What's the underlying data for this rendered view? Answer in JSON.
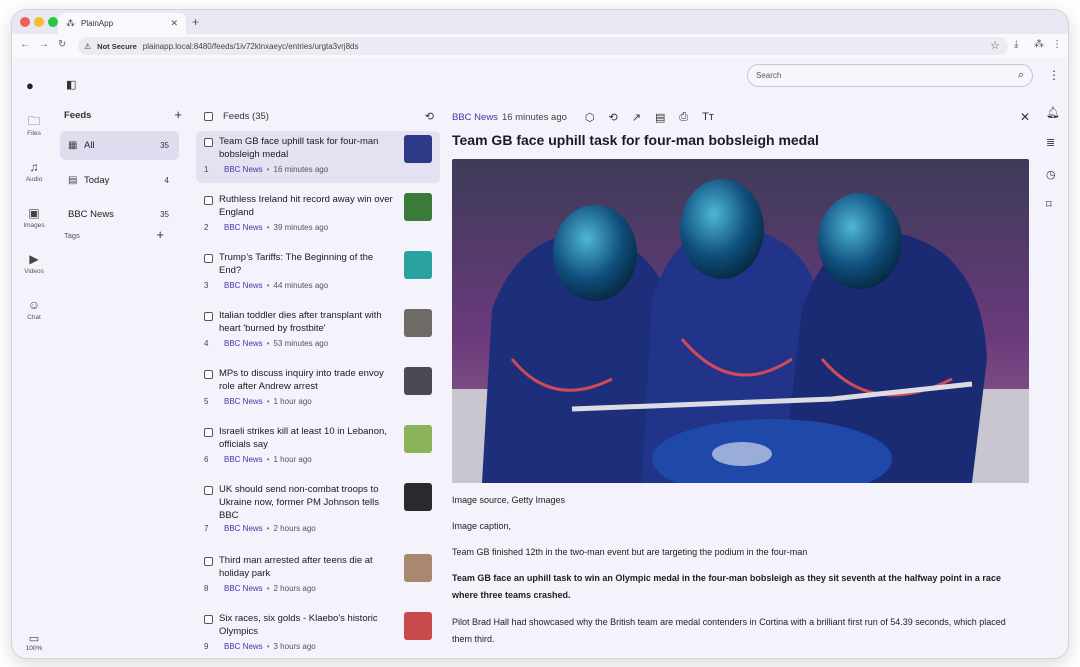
{
  "browser": {
    "tab_title": "PlainApp",
    "new_tab": "+",
    "security_label": "Not Secure",
    "url": "plainapp.local:8480/feeds/1iv72klnxaeyc/entries/urgta3vrj8ds"
  },
  "rail": {
    "items": [
      {
        "label": "Files",
        "icon": "folder-icon",
        "glyph": "🗀"
      },
      {
        "label": "Audio",
        "icon": "music-icon",
        "glyph": "♫"
      },
      {
        "label": "Images",
        "icon": "image-icon",
        "glyph": "▣"
      },
      {
        "label": "Videos",
        "icon": "video-icon",
        "glyph": "▶"
      },
      {
        "label": "Chat",
        "icon": "chat-icon",
        "glyph": "☺"
      }
    ],
    "battery": "100%"
  },
  "feeds_panel": {
    "title": "Feeds",
    "items": [
      {
        "label": "All",
        "count": "35"
      },
      {
        "label": "Today",
        "count": "4"
      },
      {
        "label": "BBC News",
        "count": "35"
      }
    ],
    "tags_label": "Tags"
  },
  "list": {
    "header": "Feeds (35)",
    "entries": [
      {
        "num": "1",
        "title": "Team GB face uphill task for four-man bobsleigh medal",
        "source": "BBC News",
        "age": "16 minutes ago",
        "thumb": "#2c3a88"
      },
      {
        "num": "2",
        "title": "Ruthless Ireland hit record away win over England",
        "source": "BBC News",
        "age": "39 minutes ago",
        "thumb": "#3b7a3a"
      },
      {
        "num": "3",
        "title": "Trump’s Tariffs: The Beginning of the End?",
        "source": "BBC News",
        "age": "44 minutes ago",
        "thumb": "#2aa3a0"
      },
      {
        "num": "4",
        "title": "Italian toddler dies after transplant with heart 'burned by frostbite'",
        "source": "BBC News",
        "age": "53 minutes ago",
        "thumb": "#6e6a66"
      },
      {
        "num": "5",
        "title": "MPs to discuss inquiry into trade envoy role after Andrew arrest",
        "source": "BBC News",
        "age": "1 hour ago",
        "thumb": "#4a4a52"
      },
      {
        "num": "6",
        "title": "Israeli strikes kill at least 10 in Lebanon, officials say",
        "source": "BBC News",
        "age": "1 hour ago",
        "thumb": "#8ab35a"
      },
      {
        "num": "7",
        "title": "UK should send non-combat troops to Ukraine now, former PM Johnson tells BBC",
        "source": "BBC News",
        "age": "2 hours ago",
        "thumb": "#2a2a2e"
      },
      {
        "num": "8",
        "title": "Third man arrested after teens die at holiday park",
        "source": "BBC News",
        "age": "2 hours ago",
        "thumb": "#a88870"
      },
      {
        "num": "9",
        "title": "Six races, six golds - Klaebo's historic Olympics",
        "source": "BBC News",
        "age": "3 hours ago",
        "thumb": "#c84a4a"
      }
    ]
  },
  "reader": {
    "source": "BBC News",
    "age": "16 minutes ago",
    "title": "Team GB face uphill task for four-man bobsleigh medal",
    "paragraphs": [
      {
        "text": "Image source, Getty Images",
        "bold": false
      },
      {
        "text": "Image caption,",
        "bold": false
      },
      {
        "text": "Team GB finished 12th in the two-man event but are targeting the podium in the four-man",
        "bold": false
      },
      {
        "text": "Team GB face an uphill task to win an Olympic medal in the four-man bobsleigh as they sit seventh at the halfway point in a race where three teams crashed.",
        "bold": true
      },
      {
        "text": "Pilot Brad Hall had showcased why the British team are medal contenders in Cortina with a brilliant first run of 54.39 seconds, which placed them third.",
        "bold": false
      }
    ]
  },
  "search": {
    "placeholder": "Search"
  },
  "colors": {
    "accent": "#3e3aa8",
    "background": "#f4f2fb",
    "active_item": "#dedcef"
  }
}
